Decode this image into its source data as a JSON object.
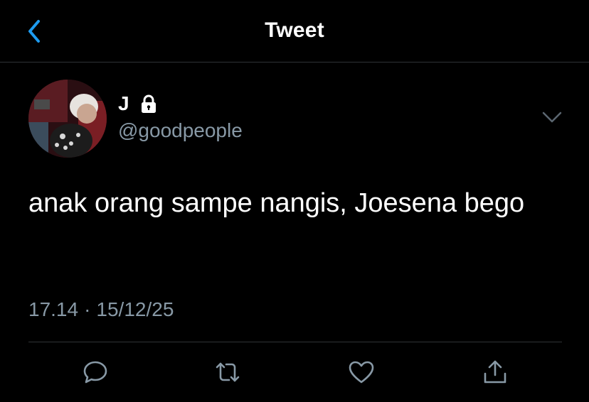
{
  "header": {
    "title": "Tweet",
    "back_icon": "chevron-left-icon"
  },
  "author": {
    "display_name": "J",
    "handle": "@goodpeople",
    "protected": true,
    "lock_icon": "lock-icon"
  },
  "tweet": {
    "text": "anak orang sampe nangis, Joesena bego",
    "time": "17.14",
    "separator": "·",
    "date": "15/12/25"
  },
  "actions": [
    {
      "name": "reply",
      "icon": "comment-icon"
    },
    {
      "name": "retweet",
      "icon": "retweet-icon"
    },
    {
      "name": "like",
      "icon": "heart-icon"
    },
    {
      "name": "share",
      "icon": "share-icon"
    }
  ],
  "colors": {
    "background": "#000000",
    "accent": "#1d9bf0",
    "text": "#ffffff",
    "secondary_text": "#8899a6",
    "divider": "#2f3336"
  }
}
